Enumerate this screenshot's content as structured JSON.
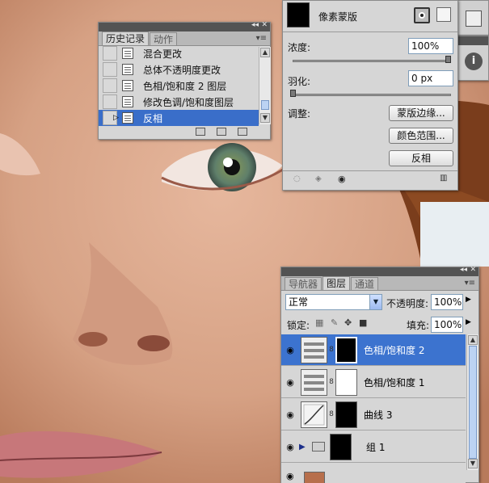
{
  "history_panel": {
    "tabs": [
      "历史记录",
      "动作"
    ],
    "rows": [
      "混合更改",
      "总体不透明度更改",
      "色相/饱和度 2 图层",
      "修改色调/饱和度图层",
      "反相"
    ],
    "selected_index": 4
  },
  "masks_panel": {
    "title": "像素蒙版",
    "density_label": "浓度:",
    "density_value": "100%",
    "feather_label": "羽化:",
    "feather_value": "0 px",
    "adjust_label": "调整:",
    "buttons": [
      "蒙版边缘...",
      "颜色范围...",
      "反相"
    ],
    "density_level": 1.0,
    "feather_level": 0.0
  },
  "layers_panel": {
    "tabs": [
      "导航器",
      "图层",
      "通道"
    ],
    "blend_mode": "正常",
    "opacity_label": "不透明度:",
    "opacity_value": "100%",
    "lock_label": "锁定:",
    "fill_label": "填充:",
    "fill_value": "100%",
    "layers": [
      {
        "name": "色相/饱和度 2",
        "type": "hue-sat",
        "mask": "black",
        "selected": true
      },
      {
        "name": "色相/饱和度 1",
        "type": "hue-sat",
        "mask": "white",
        "selected": false
      },
      {
        "name": "曲线 3",
        "type": "curves",
        "mask": "black",
        "selected": false
      },
      {
        "name": "组 1",
        "type": "group",
        "mask": "black",
        "selected": false
      }
    ]
  },
  "colors": {
    "selection": "#3a6ec9",
    "panel_bg": "#d6d6d6",
    "titlebar": "#535353"
  }
}
